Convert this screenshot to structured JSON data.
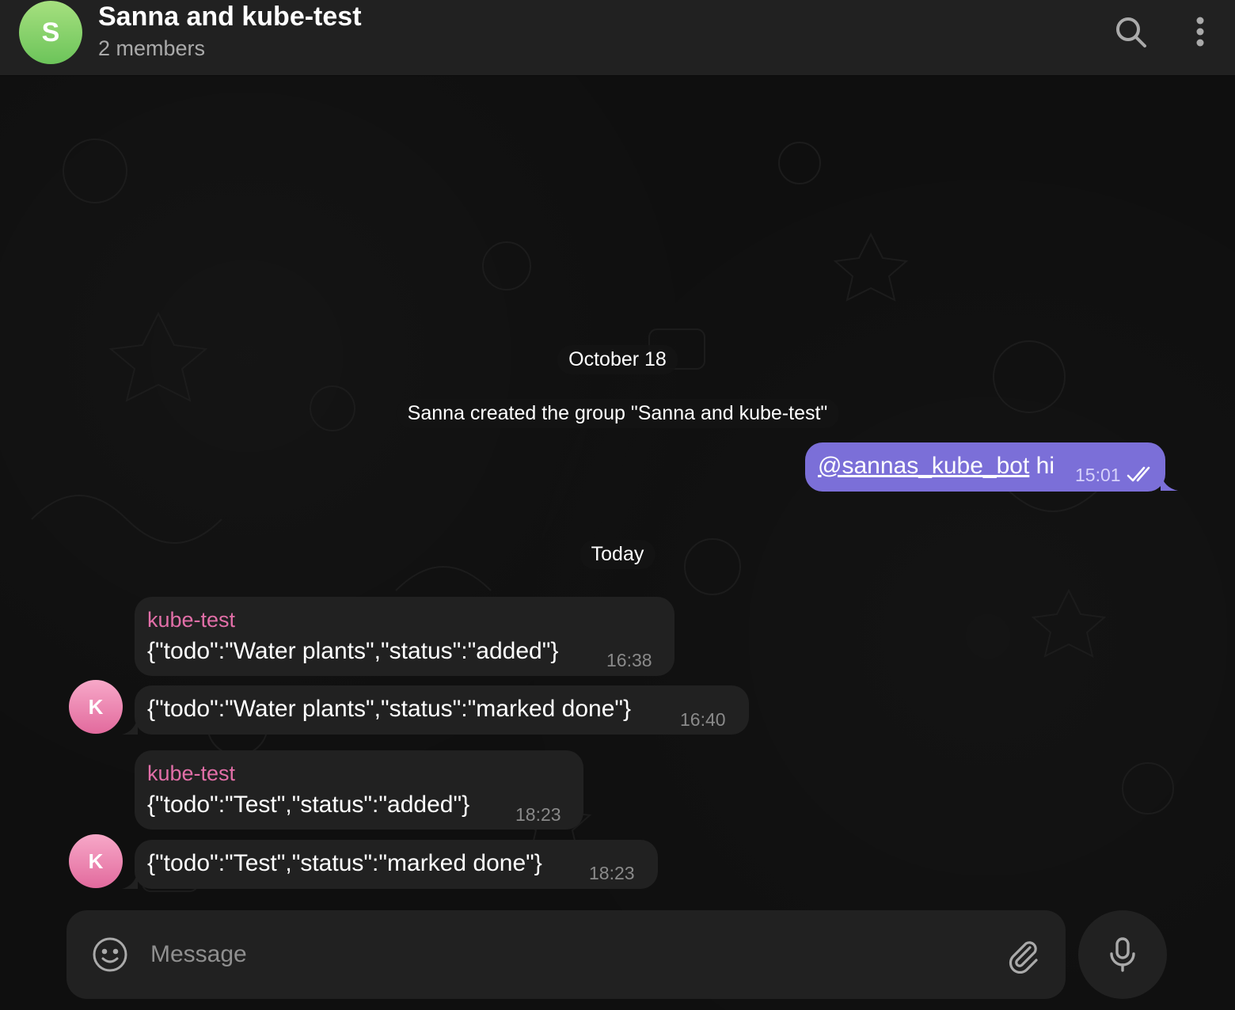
{
  "header": {
    "avatar_letter": "S",
    "title": "Sanna and kube-test",
    "subtitle": "2 members",
    "search_icon": "search-icon",
    "menu_icon": "more-vertical-icon"
  },
  "service": {
    "date_oct": "October 18",
    "group_created": "Sanna created the group \"Sanna and kube-test\"",
    "date_today": "Today"
  },
  "messages": [
    {
      "mention": "@sannas_kube_bot",
      "text": " hi",
      "time": "15:01",
      "status": "read-double-check-icon"
    },
    {
      "sender": "kube-test",
      "text": "{\"todo\":\"Water plants\",\"status\":\"added\"}",
      "time": "16:38"
    },
    {
      "text": "{\"todo\":\"Water plants\",\"status\":\"marked done\"}",
      "time": "16:40",
      "avatar_letter": "K"
    },
    {
      "sender": "kube-test",
      "text": "{\"todo\":\"Test\",\"status\":\"added\"}",
      "time": "18:23"
    },
    {
      "text": "{\"todo\":\"Test\",\"status\":\"marked done\"}",
      "time": "18:23",
      "avatar_letter": "K"
    }
  ],
  "composer": {
    "placeholder": "Message",
    "emoji_icon": "emoji-icon",
    "attach_icon": "paperclip-icon",
    "mic_icon": "microphone-icon"
  },
  "colors": {
    "header_bg": "#212121",
    "bubble_in": "#212121",
    "bubble_out": "#7b6fd8",
    "sender_name": "#e26fa8",
    "group_avatar": "#6cc45a",
    "member_avatar": "#e26a9d"
  }
}
